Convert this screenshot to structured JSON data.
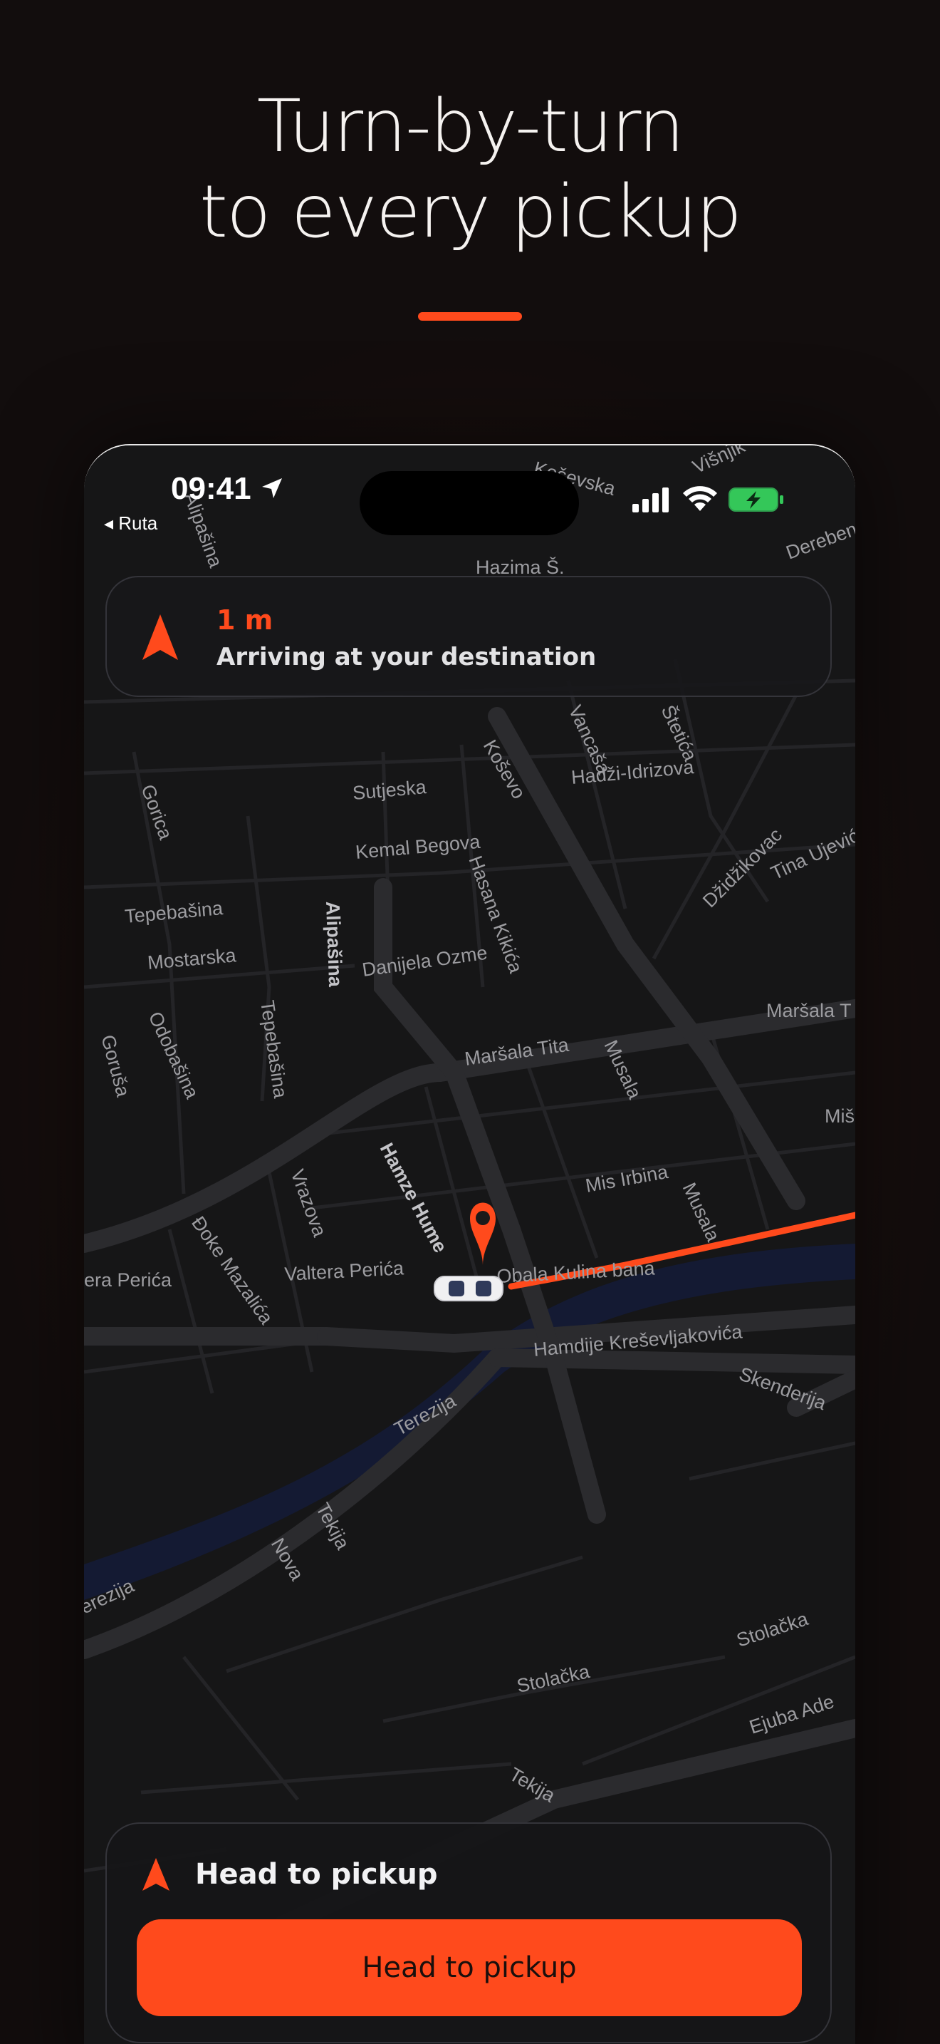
{
  "headline": {
    "line1": "Turn-by-turn",
    "line2": "to every pickup"
  },
  "colors": {
    "accent": "#ff4a1c",
    "background": "#120d0d",
    "map_background": "#161617",
    "road": "#2b2b2e",
    "river": "#141a33",
    "battery": "#34c759"
  },
  "status_bar": {
    "time": "09:41",
    "back_label": "◂ Ruta",
    "icons": [
      "location-arrow-icon",
      "cellular-signal-icon",
      "wifi-icon",
      "battery-charging-icon"
    ]
  },
  "navigation": {
    "distance": "1 m",
    "instruction": "Arriving at your destination",
    "icon": "navigation-arrow-icon"
  },
  "map": {
    "street_labels": [
      "Alipašina",
      "Koševska",
      "Višnjik",
      "Derebent",
      "Hazima Š.",
      "Vancaša",
      "Štetića",
      "Koševo",
      "Hadži-Idrizova",
      "Sutjeska",
      "Gorica",
      "Kemal Begova",
      "Hasana Kikića",
      "Džidžikovac",
      "Tina Ujević",
      "Tepebašina",
      "Mostarska",
      "Alipašina",
      "Danijela Ozme",
      "Maršala T",
      "Goruša",
      "Odobašina",
      "Tepebašina",
      "Maršala Tita",
      "Musala",
      "Miš",
      "Hamze Hume",
      "Vrazova",
      "Mis Irbina",
      "Musala",
      "Đoke Mazalića",
      "era Perića",
      "Valtera Perića",
      "Obala Kulina bana",
      "Hamdije Kreševljakovića",
      "Skenderija",
      "Terezija",
      "Tekija",
      "Nova",
      "erezija",
      "Stolačka",
      "Stolačka",
      "Ejuba Ade",
      "Tekija"
    ]
  },
  "bottom_sheet": {
    "title": "Head to pickup",
    "button_label": "Head to pickup",
    "icon": "navigation-arrow-icon"
  }
}
